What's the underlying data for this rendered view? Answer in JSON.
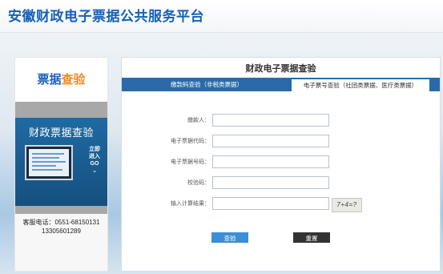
{
  "header": {
    "site_title": "安徽财政电子票据公共服务平台"
  },
  "left_panel": {
    "heading_part1": "票据",
    "heading_part2": "查验",
    "promo_title": "财政票据查验",
    "enter_label_line1": "立即",
    "enter_label_line2": "进入",
    "enter_label_line3": "GO",
    "service_line1": "客服电话：0551-68150131",
    "service_line2": "13305601289"
  },
  "main": {
    "title": "财政电子票据查验",
    "tabs": [
      {
        "label": "缴款码查验（非税类票据）",
        "active": true
      },
      {
        "label": "电子票号查验（社团类票据、医疗类票据）",
        "active": false
      }
    ],
    "fields": [
      {
        "label": "缴款人：",
        "value": ""
      },
      {
        "label": "电子票据代码：",
        "value": ""
      },
      {
        "label": "电子票据号码：",
        "value": ""
      },
      {
        "label": "校验码：",
        "value": ""
      },
      {
        "label": "输入计算结果：",
        "value": ""
      }
    ],
    "captcha_text": "7+4=?",
    "query_button": "查验",
    "reset_button": "重置"
  },
  "colors": {
    "brand_blue": "#1560b8",
    "accent_orange": "#f08a1c",
    "tab_blue": "#2a6aa8",
    "query_button": "#3a8fd6",
    "reset_button": "#333333"
  }
}
